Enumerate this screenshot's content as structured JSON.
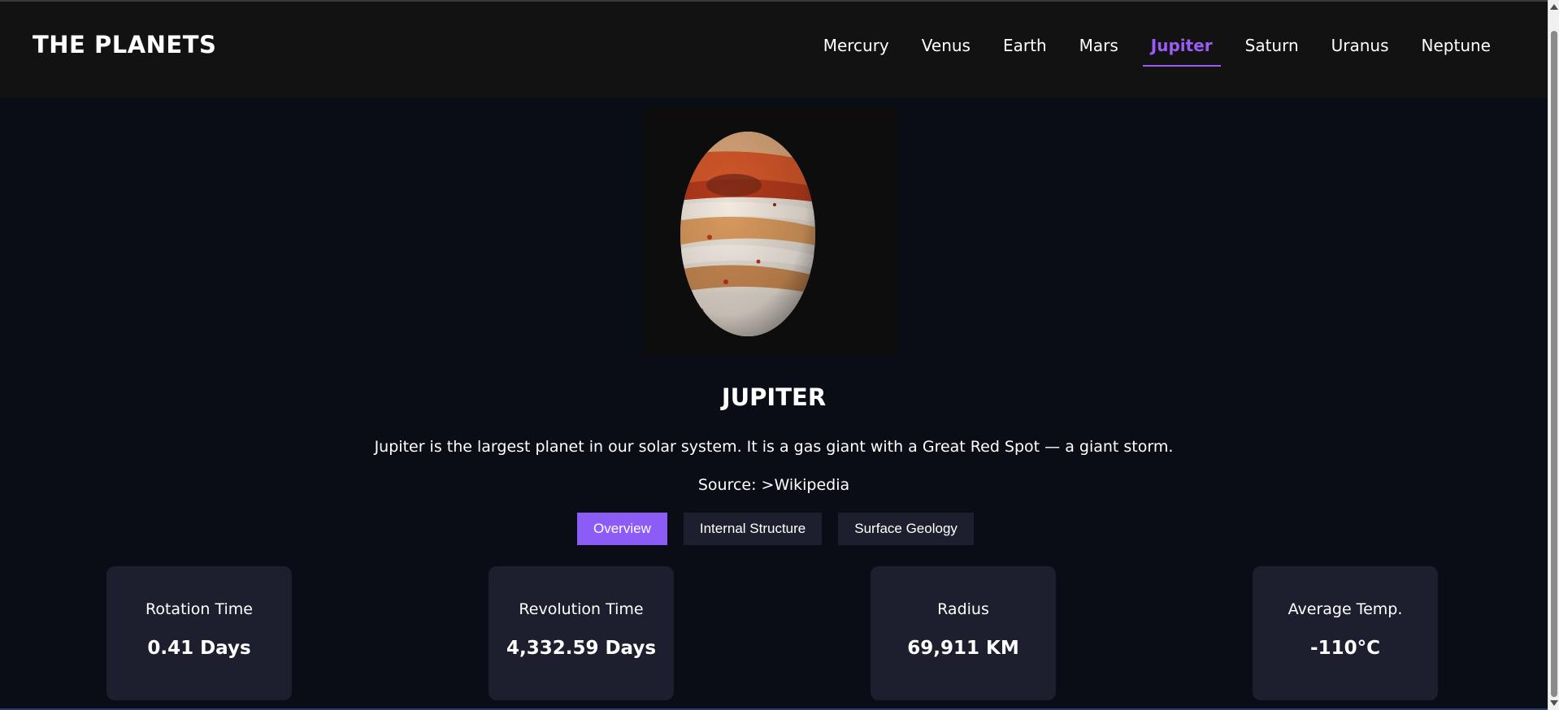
{
  "app": {
    "logo": "THE PLANETS"
  },
  "nav": {
    "items": [
      {
        "label": "Mercury"
      },
      {
        "label": "Venus"
      },
      {
        "label": "Earth"
      },
      {
        "label": "Mars"
      },
      {
        "label": "Jupiter",
        "active": true
      },
      {
        "label": "Saturn"
      },
      {
        "label": "Uranus"
      },
      {
        "label": "Neptune"
      }
    ]
  },
  "planet": {
    "name": "JUPITER",
    "description": "Jupiter is the largest planet in our solar system. It is a gas giant with a Great Red Spot — a giant storm.",
    "source": "Source: >Wikipedia",
    "image_icon": "jupiter-image"
  },
  "tabs": [
    {
      "label": "Overview",
      "active": true
    },
    {
      "label": "Internal Structure"
    },
    {
      "label": "Surface Geology"
    }
  ],
  "stats": [
    {
      "label": "Rotation Time",
      "value": "0.41 Days"
    },
    {
      "label": "Revolution Time",
      "value": "4,332.59 Days"
    },
    {
      "label": "Radius",
      "value": "69,911 KM"
    },
    {
      "label": "Average Temp.",
      "value": "-110°C"
    }
  ],
  "colors": {
    "accent": "#8b5cf6",
    "background": "#0b0d16",
    "header": "#121212",
    "card": "#1e1f2e"
  }
}
